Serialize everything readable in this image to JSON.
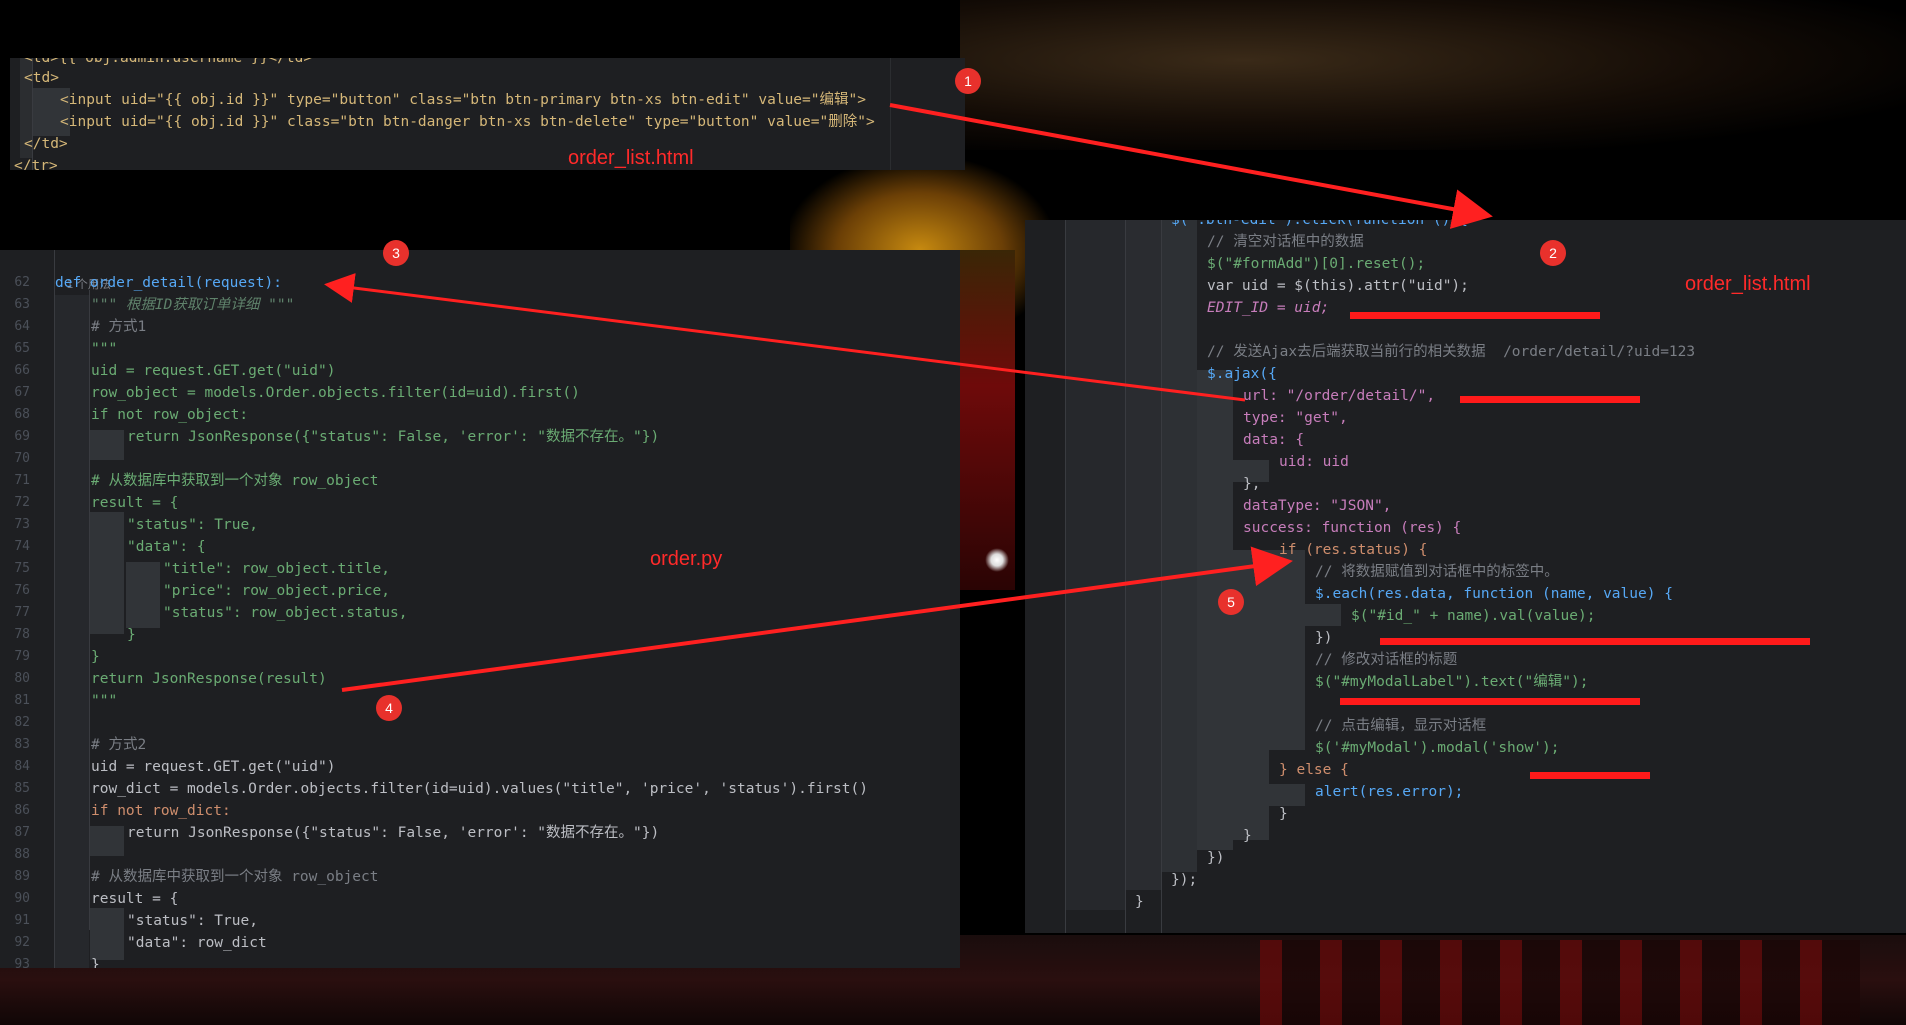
{
  "labels": {
    "top_file": "order_list.html",
    "right_file": "order_list.html",
    "left_file": "order.py"
  },
  "markers": [
    "1",
    "2",
    "3",
    "4",
    "5"
  ],
  "panel_top": {
    "lines": [
      "<td>{{ obj.admin.username }}</td>",
      "<td>",
      "<input uid=\"{{ obj.id }}\" type=\"button\" class=\"btn btn-primary btn-xs btn-edit\" value=\"编辑\">",
      "<input uid=\"{{ obj.id }}\" class=\"btn btn-danger btn-xs btn-delete\" type=\"button\" value=\"删除\">",
      "</td>",
      "</tr>"
    ]
  },
  "panel_left": {
    "usage_hint": "1 个用法",
    "line_numbers": [
      "62",
      "63",
      "64",
      "65",
      "66",
      "67",
      "68",
      "69",
      "70",
      "71",
      "72",
      "73",
      "74",
      "75",
      "76",
      "77",
      "78",
      "79",
      "80",
      "81",
      "82",
      "83",
      "84",
      "85",
      "86",
      "87",
      "88",
      "89",
      "90",
      "91",
      "92",
      "93"
    ],
    "lines": [
      "def order_detail(request):",
      "\"\"\" 根据ID获取订单详细 \"\"\"",
      "# 方式1",
      "\"\"\"",
      "uid = request.GET.get(\"uid\")",
      "row_object = models.Order.objects.filter(id=uid).first()",
      "if not row_object:",
      "return JsonResponse({\"status\": False, 'error': \"数据不存在。\"})",
      "",
      "# 从数据库中获取到一个对象 row_object",
      "result = {",
      "\"status\": True,",
      "\"data\": {",
      "\"title\": row_object.title,",
      "\"price\": row_object.price,",
      "\"status\": row_object.status,",
      "}",
      "}",
      "return JsonResponse(result)",
      "\"\"\"",
      "",
      "# 方式2",
      "uid = request.GET.get(\"uid\")",
      "row_dict = models.Order.objects.filter(id=uid).values(\"title\", 'price', 'status').first()",
      "if not row_dict:",
      "return JsonResponse({\"status\": False, 'error': \"数据不存在。\"})",
      "",
      "# 从数据库中获取到一个对象 row_object",
      "result = {",
      "\"status\": True,",
      "\"data\": row_dict",
      "}"
    ]
  },
  "panel_right": {
    "lines": [
      "$(\".btn-edit\").click(function () {",
      "// 清空对话框中的数据",
      "$(\"#formAdd\")[0].reset();",
      "var uid = $(this).attr(\"uid\");",
      "EDIT_ID = uid;",
      "",
      "// 发送Ajax去后端获取当前行的相关数据  /order/detail/?uid=123",
      "$.ajax({",
      "url: \"/order/detail/\",",
      "type: \"get\",",
      "data: {",
      "uid: uid",
      "},",
      "dataType: \"JSON\",",
      "success: function (res) {",
      "if (res.status) {",
      "// 将数据赋值到对话框中的标签中。",
      "$.each(res.data, function (name, value) {",
      "$(\"#id_\" + name).val(value);",
      "})",
      "// 修改对话框的标题",
      "$(\"#myModalLabel\").text(\"编辑\");",
      "",
      "// 点击编辑，显示对话框",
      "$('#myModal').modal('show');",
      "} else {",
      "alert(res.error);",
      "}",
      "}",
      "})",
      "});",
      "}"
    ]
  },
  "colors": {
    "editor_bg": "#1e1f22",
    "annotation_red": "#ff2a2a",
    "marker_red": "#e8312c"
  }
}
